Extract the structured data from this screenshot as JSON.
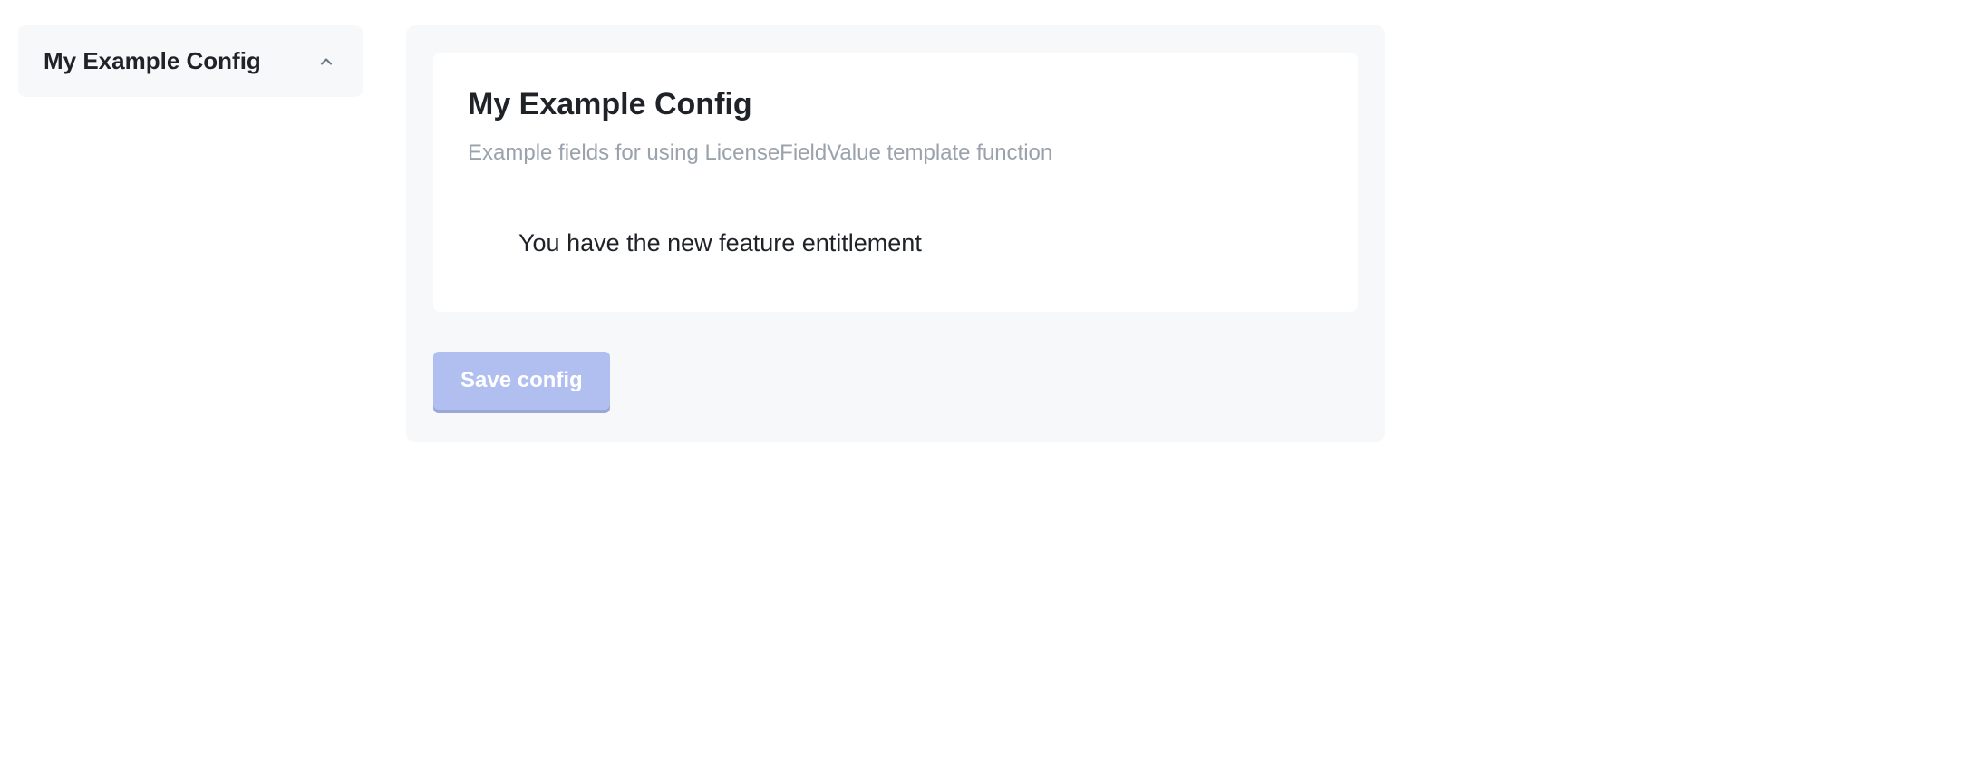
{
  "sidebar": {
    "items": [
      {
        "label": "My Example Config"
      }
    ]
  },
  "main": {
    "title": "My Example Config",
    "subtitle": "Example fields for using LicenseFieldValue template function",
    "entitlement_message": "You have the new feature entitlement"
  },
  "actions": {
    "save_label": "Save config"
  }
}
